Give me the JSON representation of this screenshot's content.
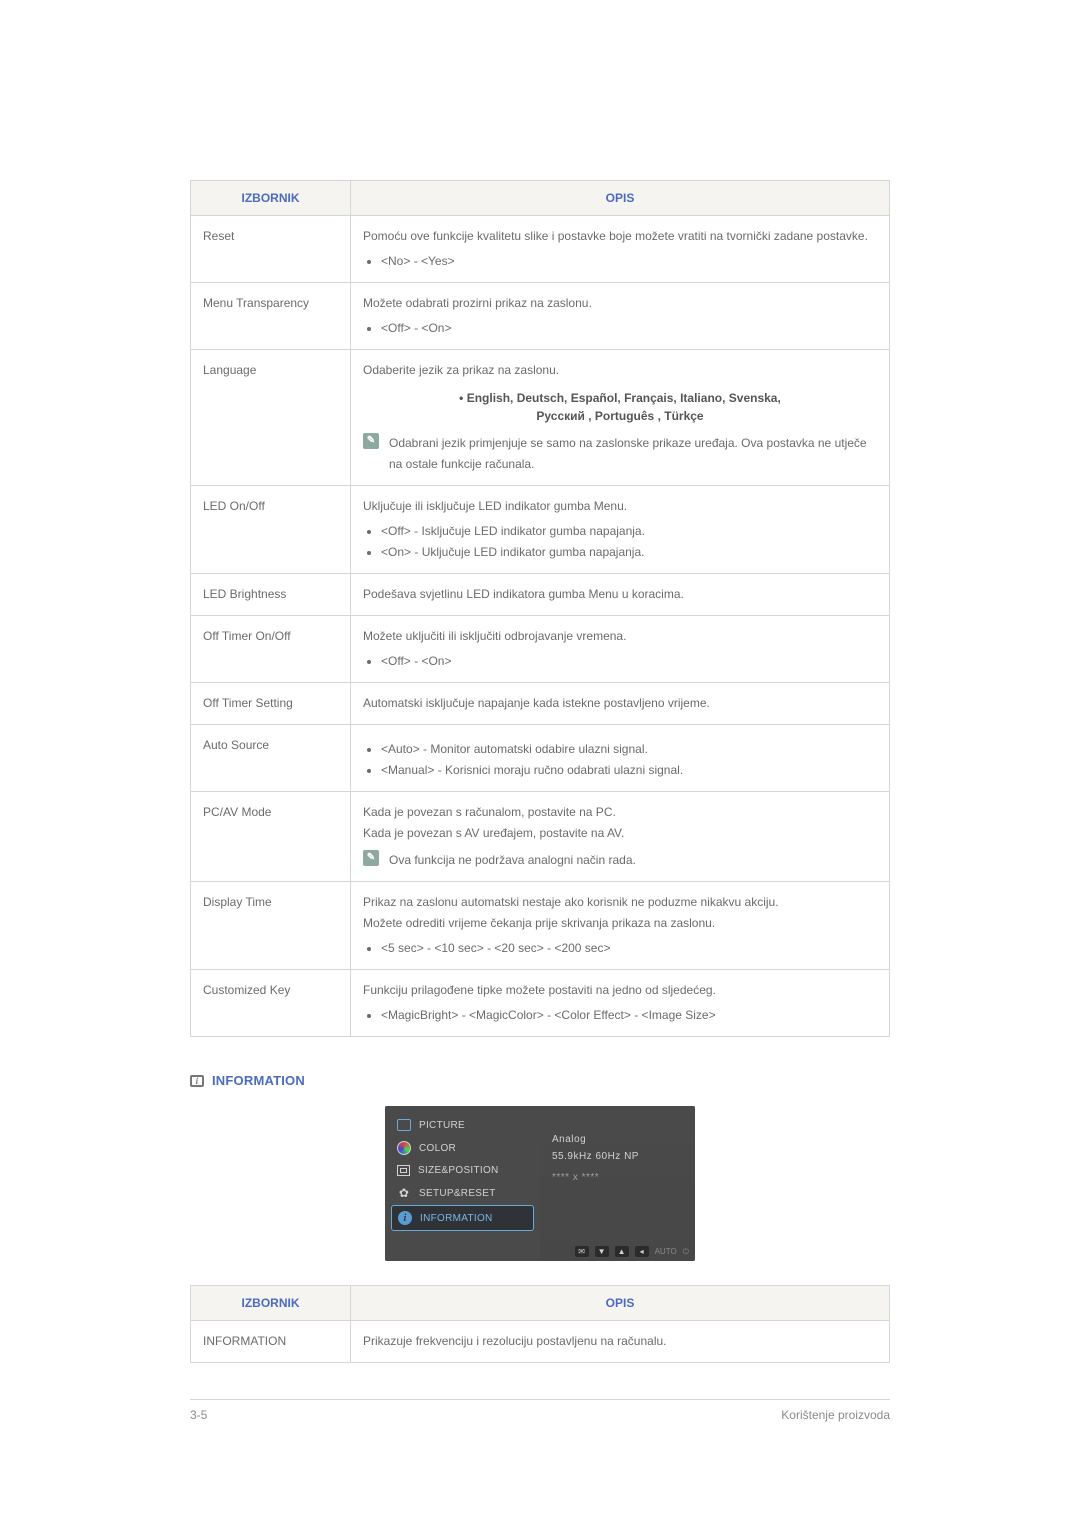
{
  "table1": {
    "headers": [
      "IZBORNIK",
      "OPIS"
    ],
    "rows": [
      {
        "label": "Reset",
        "desc": "Pomoću ove funkcije kvalitetu slike i postavke boje možete vratiti na tvornički zadane postavke.",
        "bullets": [
          "<No> - <Yes>"
        ]
      },
      {
        "label": "Menu Transparency",
        "desc": "Možete odabrati prozirni prikaz na zaslonu.",
        "bullets": [
          "<Off> - <On>"
        ]
      },
      {
        "label": "Language",
        "desc": "Odaberite jezik za prikaz na zaslonu.",
        "center_line1": "• English, Deutsch, Español, Français,  Italiano, Svenska,",
        "center_line2": "Русский , Português , Türkçe",
        "note": "Odabrani jezik primjenjuje se samo na zaslonske prikaze uređaja. Ova postavka ne utječe na ostale funkcije računala."
      },
      {
        "label": "LED On/Off",
        "desc": "Uključuje ili isključuje LED indikator gumba Menu.",
        "bullets": [
          "<Off> - Isključuje LED indikator gumba napajanja.",
          "<On> - Uključuje LED indikator gumba napajanja."
        ]
      },
      {
        "label": "LED Brightness",
        "desc": "Podešava svjetlinu LED indikatora gumba Menu u koracima."
      },
      {
        "label": "Off Timer On/Off",
        "desc": "Možete uključiti ili isključiti odbrojavanje vremena.",
        "bullets": [
          "<Off> - <On>"
        ]
      },
      {
        "label": "Off Timer Setting",
        "desc": "Automatski isključuje napajanje kada istekne postavljeno vrijeme."
      },
      {
        "label": "Auto Source",
        "bullets": [
          "<Auto> - Monitor automatski odabire ulazni signal.",
          "<Manual> - Korisnici moraju ručno odabrati ulazni signal."
        ]
      },
      {
        "label": "PC/AV Mode",
        "desc": "Kada je povezan s računalom, postavite na PC.",
        "desc2": "Kada je povezan s AV uređajem, postavite na AV.",
        "note": "Ova funkcija ne podržava analogni način rada."
      },
      {
        "label": "Display Time",
        "desc": "Prikaz na zaslonu automatski nestaje ako korisnik ne poduzme nikakvu akciju.",
        "desc2": "Možete odrediti vrijeme čekanja prije skrivanja prikaza na zaslonu.",
        "bullets": [
          "<5 sec> - <10 sec> - <20 sec> - <200 sec>"
        ]
      },
      {
        "label": "Customized Key",
        "desc": "Funkciju prilagođene tipke možete postaviti na jedno od sljedećeg.",
        "bullets": [
          "<MagicBright> - <MagicColor> - <Color Effect> - <Image Size>"
        ]
      }
    ]
  },
  "section_heading": "INFORMATION",
  "osd": {
    "items": [
      {
        "label": "PICTURE"
      },
      {
        "label": "COLOR"
      },
      {
        "label": "SIZE&POSITION"
      },
      {
        "label": "SETUP&RESET"
      },
      {
        "label": "INFORMATION"
      }
    ],
    "right_line1": "Analog",
    "right_line2": "55.9kHz 60Hz NP",
    "right_dots": "**** x ****",
    "bottom_auto": "AUTO"
  },
  "table2": {
    "headers": [
      "IZBORNIK",
      "OPIS"
    ],
    "rows": [
      {
        "label": "INFORMATION",
        "desc": "Prikazuje frekvenciju i rezoluciju postavljenu na računalu."
      }
    ]
  },
  "footer": {
    "left": "3-5",
    "right": "Korištenje proizvoda"
  }
}
